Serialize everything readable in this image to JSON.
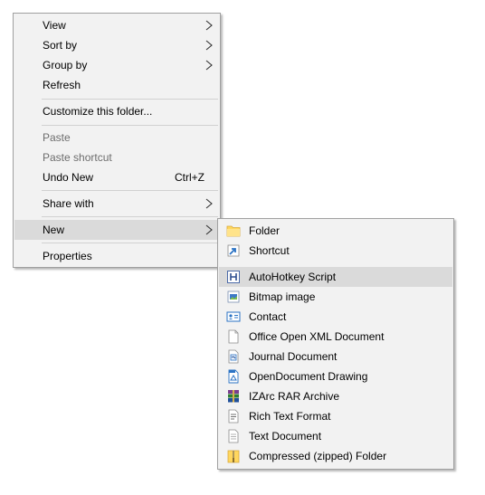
{
  "context_menu": {
    "items": [
      {
        "label": "View",
        "submenu": true
      },
      {
        "label": "Sort by",
        "submenu": true
      },
      {
        "label": "Group by",
        "submenu": true
      },
      {
        "label": "Refresh"
      },
      {
        "label": "Customize this folder..."
      },
      {
        "label": "Paste",
        "disabled": true
      },
      {
        "label": "Paste shortcut",
        "disabled": true
      },
      {
        "label": "Undo New",
        "shortcut": "Ctrl+Z"
      },
      {
        "label": "Share with",
        "submenu": true
      },
      {
        "label": "New",
        "submenu": true,
        "active": true
      },
      {
        "label": "Properties"
      }
    ]
  },
  "new_submenu": {
    "items": [
      {
        "label": "Folder",
        "icon": "folder-icon"
      },
      {
        "label": "Shortcut",
        "icon": "shortcut-icon"
      },
      {
        "label": "AutoHotkey Script",
        "icon": "autohotkey-script-icon",
        "active": true
      },
      {
        "label": "Bitmap image",
        "icon": "bitmap-image-icon"
      },
      {
        "label": "Contact",
        "icon": "contact-icon"
      },
      {
        "label": "Office Open XML Document",
        "icon": "document-icon"
      },
      {
        "label": "Journal Document",
        "icon": "journal-document-icon"
      },
      {
        "label": "OpenDocument Drawing",
        "icon": "opendocument-drawing-icon"
      },
      {
        "label": "IZArc RAR Archive",
        "icon": "rar-archive-icon"
      },
      {
        "label": "Rich Text Format",
        "icon": "rich-text-icon"
      },
      {
        "label": "Text Document",
        "icon": "text-document-icon"
      },
      {
        "label": "Compressed (zipped) Folder",
        "icon": "zipped-folder-icon"
      }
    ]
  },
  "colors": {
    "menu_background": "#f2f2f2",
    "hover_background": "#dadada",
    "disabled_text": "#6d6d6d",
    "folder_yellow": "#ffd75e",
    "accent_blue": "#2b73c4"
  }
}
